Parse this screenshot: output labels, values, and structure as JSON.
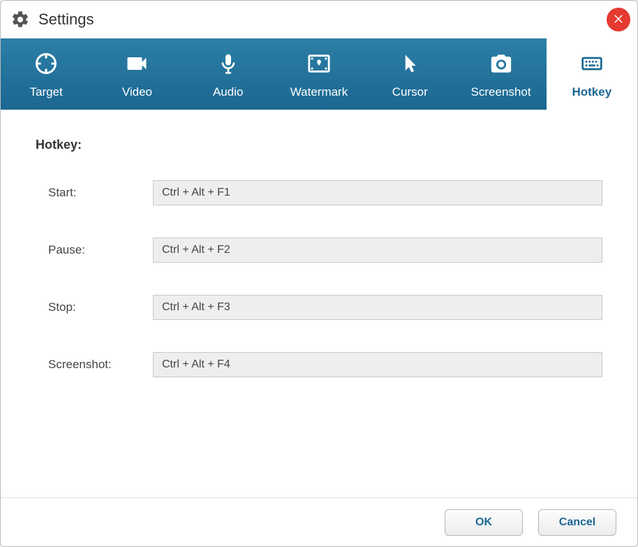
{
  "window": {
    "title": "Settings"
  },
  "tabs": [
    {
      "label": "Target"
    },
    {
      "label": "Video"
    },
    {
      "label": "Audio"
    },
    {
      "label": "Watermark"
    },
    {
      "label": "Cursor"
    },
    {
      "label": "Screenshot"
    },
    {
      "label": "Hotkey"
    }
  ],
  "section": {
    "header": "Hotkey:"
  },
  "fields": [
    {
      "label": "Start:",
      "value": "Ctrl + Alt + F1"
    },
    {
      "label": "Pause:",
      "value": "Ctrl + Alt + F2"
    },
    {
      "label": "Stop:",
      "value": "Ctrl + Alt + F3"
    },
    {
      "label": "Screenshot:",
      "value": "Ctrl + Alt + F4"
    }
  ],
  "footer": {
    "ok": "OK",
    "cancel": "Cancel"
  }
}
